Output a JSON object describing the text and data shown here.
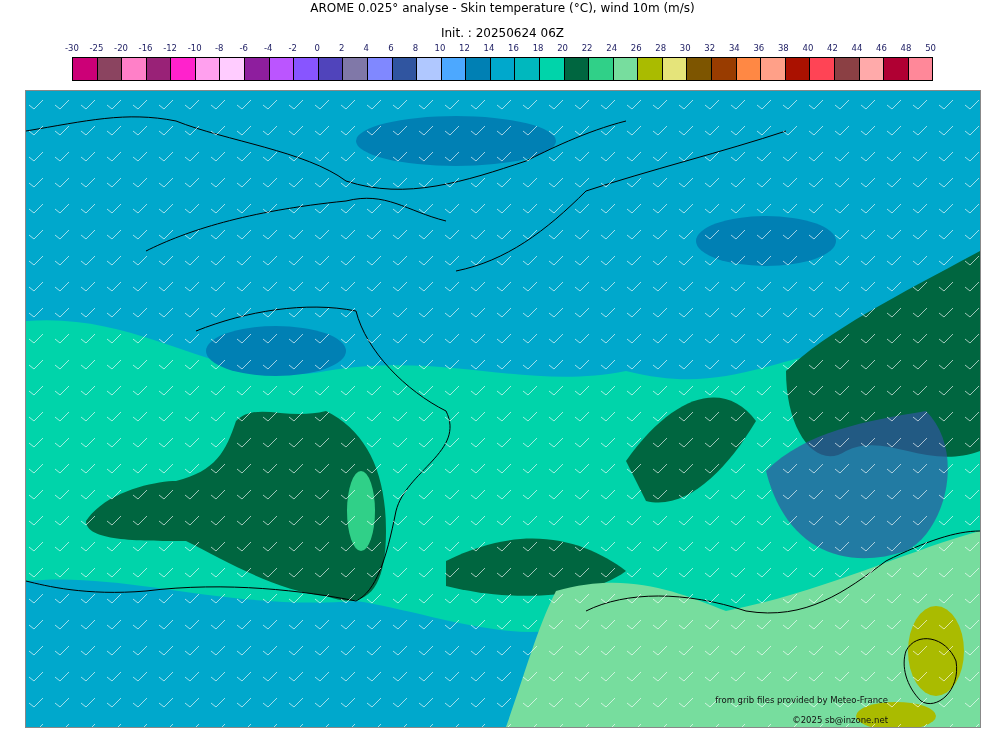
{
  "title": "AROME 0.025° analyse - Skin temperature (°C), wind 10m (m/s)",
  "subtitle": "Init. : 20250624 06Z",
  "colorbar": {
    "labels": [
      "-30",
      "-25",
      "-20",
      "-16",
      "-12",
      "-10",
      "-8",
      "-6",
      "-4",
      "-2",
      "0",
      "2",
      "4",
      "6",
      "8",
      "10",
      "12",
      "14",
      "16",
      "18",
      "20",
      "22",
      "24",
      "26",
      "28",
      "30",
      "32",
      "34",
      "36",
      "38",
      "40",
      "42",
      "44",
      "46",
      "48",
      "50"
    ],
    "swatches": [
      {
        "color": "#cc0077"
      },
      {
        "color": "#8b4460"
      },
      {
        "color": "#ff80c8"
      },
      {
        "color": "#992277"
      },
      {
        "color": "#ff22cc"
      },
      {
        "color": "#ffa0ee"
      },
      {
        "color": "#ffccff"
      },
      {
        "color": "#8e1e9e"
      },
      {
        "color": "#bb55ff"
      },
      {
        "color": "#8855ff"
      },
      {
        "color": "#5044bb"
      },
      {
        "color": "#8078a8"
      },
      {
        "color": "#8088ff"
      },
      {
        "color": "#3055a0"
      },
      {
        "color": "#b0c8ff"
      },
      {
        "color": "#4ca8ff"
      },
      {
        "color": "#0080b4"
      },
      {
        "color": "#00a8cc"
      },
      {
        "color": "#00b8be"
      },
      {
        "color": "#00d4aa"
      },
      {
        "color": "#006640"
      },
      {
        "color": "#30d088"
      },
      {
        "color": "#77dd9e"
      },
      {
        "color": "#aabb00"
      },
      {
        "color": "#e5e47a"
      },
      {
        "color": "#7d5500"
      },
      {
        "color": "#993c00"
      },
      {
        "color": "#ff8844"
      },
      {
        "color": "#ffa088"
      },
      {
        "color": "#aa1100"
      },
      {
        "color": "#ff4455"
      },
      {
        "color": "#8b4044"
      },
      {
        "color": "#ffaaaa"
      },
      {
        "color": "#b00033"
      },
      {
        "color": "#ff8899"
      }
    ]
  },
  "credits": [
    "from grib files provided by Meteo-France",
    "©2025 sb@inzone.net"
  ]
}
